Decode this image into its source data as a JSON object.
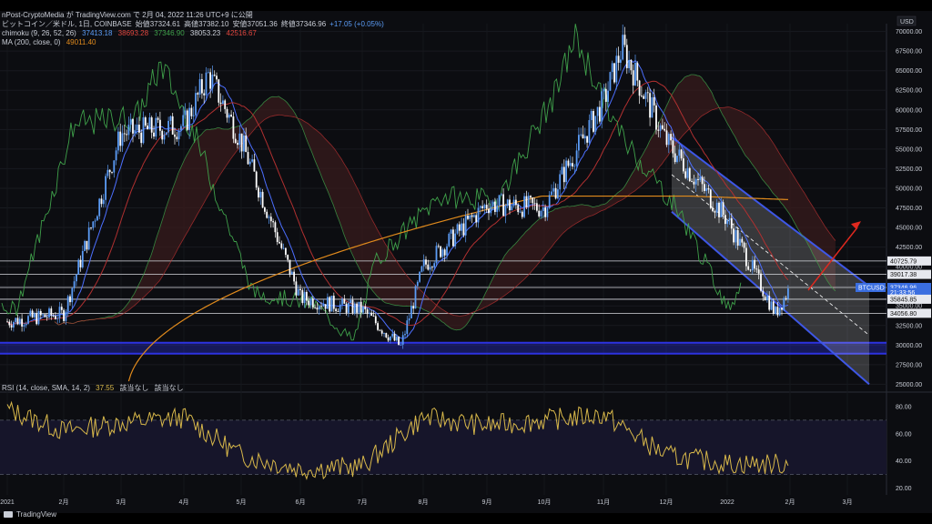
{
  "header": {
    "line1": "ビットコイン／米ドル, 1日, COINBASE",
    "o_label": "始値",
    "o_val": "37324.61",
    "h_label": "高値",
    "h_val": "37382.10",
    "l_label": "安値",
    "l_val": "37051.36",
    "c_label": "終値",
    "c_val": "37346.96",
    "chg": "+17.05 (+0.05%)",
    "published": "nPost-CryptoMedia が TradingView.com で 2月 04, 2022 11:26 UTC+9 に公開",
    "ichimoku": "chimoku (9, 26, 52, 26)",
    "ichi_v1": "37413.18",
    "ichi_v2": "38693.28",
    "ichi_v3": "37346.90",
    "ichi_v4": "38053.23",
    "ichi_v5": "42516.67",
    "ma": "MA (200, close, 0)",
    "ma_val": "49011.40"
  },
  "rsi_header": {
    "label": "RSI (14, close, SMA, 14, 2)",
    "value": "37.55",
    "na1": "該当なし",
    "na2": "該当なし"
  },
  "colors": {
    "up": "#5b9cf6",
    "down": "#ffffff",
    "tenkan": "#4c6fff",
    "kijun": "#b03030",
    "lagging": "#3fa04a",
    "cloud_up": "#1f3b22",
    "cloud_down": "#3b1c1c",
    "ma200": "#e08a1c",
    "rsi": "#d8b84a",
    "channel": "#3e57e6",
    "arrow": "#e0291f",
    "band": "#2c32e0",
    "header_blue": "#5b9cf6",
    "header_red": "#e0463e",
    "header_green": "#3fa04a",
    "header_orange": "#e08a1c"
  },
  "footer": {
    "brand": "TradingView"
  },
  "chart_data": [
    {
      "type": "line",
      "title": "ビットコイン／米ドル, 1日, COINBASE",
      "unit": "USD",
      "y_ticks": [
        25000,
        27500,
        30000,
        32500,
        35000,
        37500,
        40000,
        42500,
        45000,
        47500,
        50000,
        52500,
        55000,
        57500,
        60000,
        62500,
        65000,
        67500,
        70000
      ],
      "ylim": [
        24000,
        71000
      ],
      "x_ticks": [
        "2021",
        "2月",
        "3月",
        "4月",
        "5月",
        "6月",
        "7月",
        "8月",
        "9月",
        "10月",
        "11月",
        "12月",
        "2022",
        "2月",
        "3月"
      ],
      "series": [
        {
          "name": "BTCUSD",
          "x": [
            "2021-01",
            "2021-02",
            "2021-03",
            "2021-04",
            "2021-04-14",
            "2021-05",
            "2021-06",
            "2021-07",
            "2021-07-20",
            "2021-08",
            "2021-09",
            "2021-10",
            "2021-11",
            "2021-11-10",
            "2021-12",
            "2022-01",
            "2022-01-24",
            "2022-02"
          ],
          "values": [
            33000,
            34000,
            57000,
            58000,
            64500,
            56000,
            36000,
            34500,
            29800,
            40000,
            48000,
            47500,
            61000,
            68000,
            56000,
            46000,
            34000,
            37346.96
          ]
        }
      ],
      "price_labels": [
        {
          "text": "40725.79",
          "value": 40725.79
        },
        {
          "text": "39017.38",
          "value": 39017.38
        },
        {
          "text": "BTCUSD",
          "value": 37346.96
        },
        {
          "text": "37346.96",
          "value": 37346.96
        },
        {
          "text": "21:33:56",
          "value": 36700
        },
        {
          "text": "35845.85",
          "value": 35845.85
        },
        {
          "text": "34056.80",
          "value": 34056.8
        }
      ],
      "horizontal_levels": [
        40725.79,
        39017.38,
        37346.96,
        35845.85,
        34056.8
      ],
      "support_band": [
        28900,
        30300
      ]
    },
    {
      "type": "line",
      "title": "RSI (14, close, SMA, 14, 2)",
      "y_ticks": [
        20,
        40,
        60,
        80
      ],
      "ylim": [
        15,
        90
      ],
      "series": [
        {
          "name": "RSI",
          "x": [
            "2021-01",
            "2021-02",
            "2021-03",
            "2021-04",
            "2021-05",
            "2021-06",
            "2021-07",
            "2021-08",
            "2021-09",
            "2021-10",
            "2021-11",
            "2021-12",
            "2022-01",
            "2022-02"
          ],
          "values": [
            78,
            62,
            68,
            72,
            44,
            34,
            36,
            72,
            66,
            70,
            74,
            44,
            38,
            37.55
          ]
        }
      ]
    }
  ]
}
